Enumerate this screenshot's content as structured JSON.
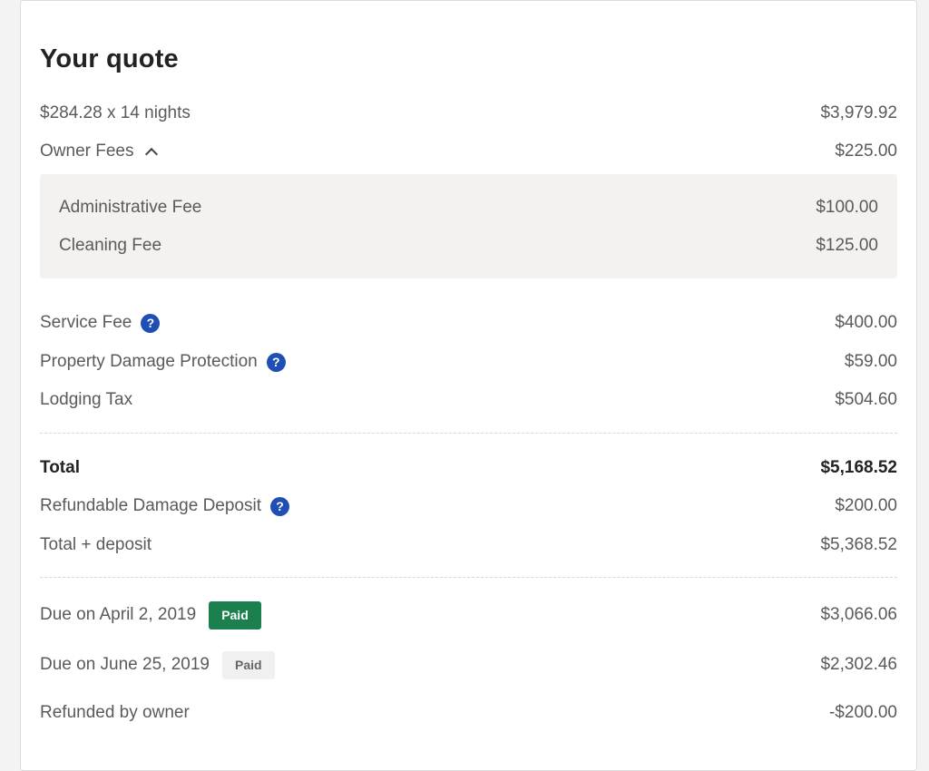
{
  "quote": {
    "title": "Your quote",
    "nightly": {
      "label": "$284.28 x 14 nights",
      "amount": "$3,979.92"
    },
    "owner_fees": {
      "label": "Owner Fees",
      "amount": "$225.00",
      "items": [
        {
          "label": "Administrative Fee",
          "amount": "$100.00"
        },
        {
          "label": "Cleaning Fee",
          "amount": "$125.00"
        }
      ]
    },
    "service_fee": {
      "label": "Service Fee",
      "amount": "$400.00",
      "help": "?"
    },
    "damage_protection": {
      "label": "Property Damage Protection",
      "amount": "$59.00",
      "help": "?"
    },
    "lodging_tax": {
      "label": "Lodging Tax",
      "amount": "$504.60"
    },
    "total": {
      "label": "Total",
      "amount": "$5,168.52"
    },
    "deposit": {
      "label": "Refundable Damage Deposit",
      "amount": "$200.00",
      "help": "?"
    },
    "total_deposit": {
      "label": "Total + deposit",
      "amount": "$5,368.52"
    },
    "payments": [
      {
        "label": "Due on April 2, 2019",
        "badge": "Paid",
        "badge_style": "green",
        "amount": "$3,066.06"
      },
      {
        "label": "Due on June 25, 2019",
        "badge": "Paid",
        "badge_style": "grey",
        "amount": "$2,302.46"
      }
    ],
    "refund": {
      "label": "Refunded by owner",
      "amount": "-$200.00"
    }
  },
  "colors": {
    "help_icon": "#1f4fb5",
    "paid_green": "#1b7f4e",
    "fees_box_bg": "#f4f2f0"
  },
  "icons": {
    "owner_fees_toggle": "chevron-up-icon",
    "help": "question-circle-icon"
  }
}
